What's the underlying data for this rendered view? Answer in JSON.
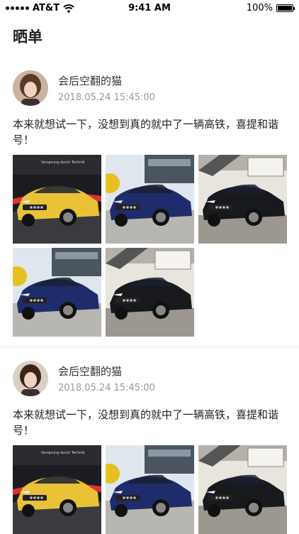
{
  "status_bar": {
    "carrier": "AT&T",
    "time": "9:41 AM",
    "battery": "100%",
    "battery_level": 1.0
  },
  "page_title": "晒单",
  "posts": [
    {
      "username": "会后空翻的猫",
      "date": "2018.05.24 15:45:00",
      "text": "本来就想试一下，没想到真的就中了一辆高铁，喜提和谐号！",
      "photos": [
        {
          "car_color": "#e9c237",
          "scene": "showroom-dark",
          "sign_text": "Vorsprung durch Technik"
        },
        {
          "car_color": "#1f2c6b",
          "scene": "outdoor"
        },
        {
          "car_color": "#18191c",
          "scene": "garage"
        },
        {
          "car_color": "#1f2c6b",
          "scene": "outdoor"
        },
        {
          "car_color": "#18191c",
          "scene": "garage"
        }
      ]
    },
    {
      "username": "会后空翻的猫",
      "date": "2018.05.24 15:45:00",
      "text": "本来就想试一下，没想到真的就中了一辆高铁，喜提和谐号！",
      "photos": [
        {
          "car_color": "#e9c237",
          "scene": "showroom-dark",
          "sign_text": "Vorsprung durch Technik"
        },
        {
          "car_color": "#1f2c6b",
          "scene": "outdoor"
        },
        {
          "car_color": "#18191c",
          "scene": "garage"
        }
      ]
    }
  ]
}
